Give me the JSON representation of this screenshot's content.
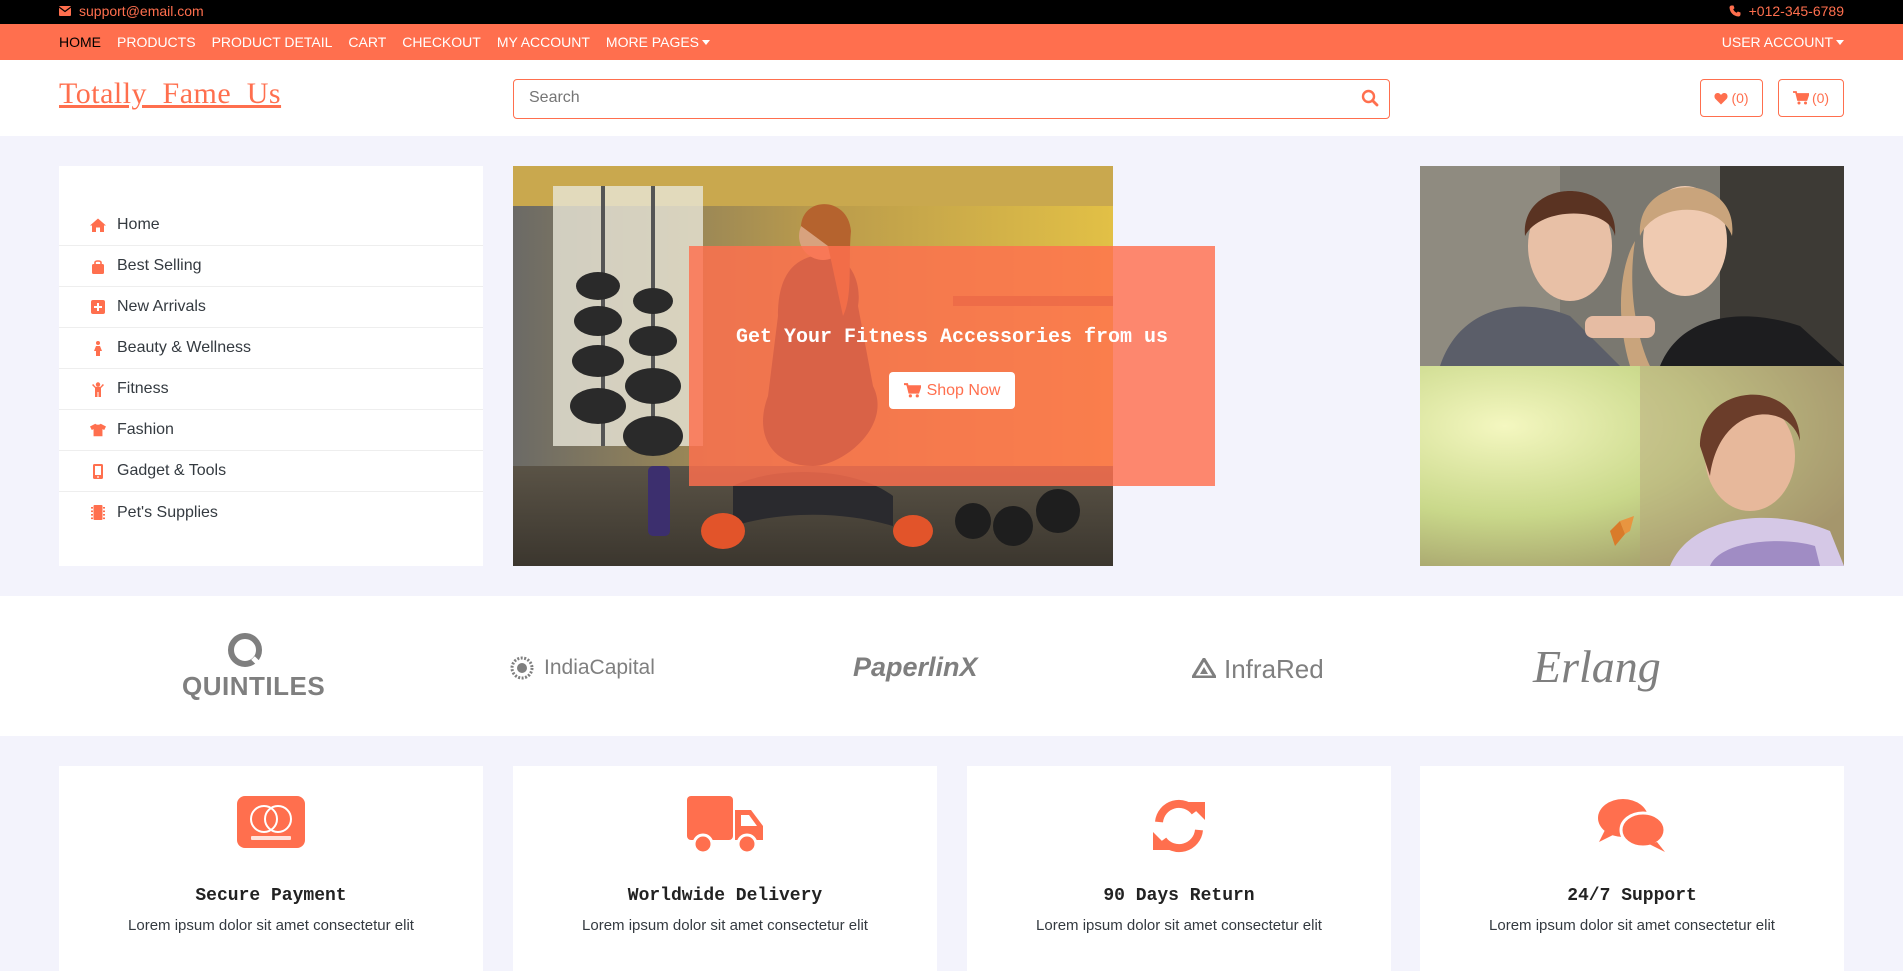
{
  "topbar": {
    "email": "support@email.com",
    "phone": "+012-345-6789"
  },
  "nav": {
    "items": [
      {
        "label": "HOME"
      },
      {
        "label": "PRODUCTS"
      },
      {
        "label": "PRODUCT DETAIL"
      },
      {
        "label": "CART"
      },
      {
        "label": "CHECKOUT"
      },
      {
        "label": "MY ACCOUNT"
      },
      {
        "label": "MORE PAGES"
      }
    ],
    "user_account": "USER ACCOUNT"
  },
  "header": {
    "logo": "Totally_Fame_Us",
    "search_placeholder": "Search",
    "wishlist_count": "(0)",
    "cart_count": "(0)"
  },
  "sidebar": {
    "items": [
      {
        "label": "Home",
        "icon": "home-icon"
      },
      {
        "label": "Best Selling",
        "icon": "shopping-bag-icon"
      },
      {
        "label": "New Arrivals",
        "icon": "plus-square-icon"
      },
      {
        "label": "Beauty & Wellness",
        "icon": "female-icon"
      },
      {
        "label": "Fitness",
        "icon": "child-icon"
      },
      {
        "label": "Fashion",
        "icon": "tshirt-icon"
      },
      {
        "label": "Gadget & Tools",
        "icon": "mobile-icon"
      },
      {
        "label": "Pet's Supplies",
        "icon": "microchip-icon"
      }
    ]
  },
  "hero": {
    "title": "Get Your Fitness Accessories from us",
    "button": "Shop Now"
  },
  "brands": {
    "items": [
      {
        "name": "QUINTILES"
      },
      {
        "name": "IndiaCapital"
      },
      {
        "name": "PaperlinX"
      },
      {
        "name": "InfraRed"
      },
      {
        "name": "Erlang"
      }
    ]
  },
  "features": {
    "items": [
      {
        "title": "Secure Payment",
        "desc": "Lorem ipsum dolor sit amet consectetur elit"
      },
      {
        "title": "Worldwide Delivery",
        "desc": "Lorem ipsum dolor sit amet consectetur elit"
      },
      {
        "title": "90 Days Return",
        "desc": "Lorem ipsum dolor sit amet consectetur elit"
      },
      {
        "title": "24/7 Support",
        "desc": "Lorem ipsum dolor sit amet consectetur elit"
      }
    ]
  },
  "colors": {
    "accent": "#ff6f4e",
    "page_bg": "#f3f3fc"
  }
}
